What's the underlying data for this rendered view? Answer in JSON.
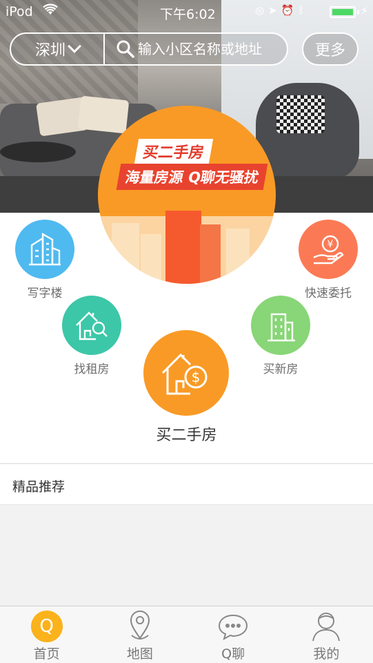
{
  "status_bar": {
    "carrier": "iPod",
    "time": "下午6:02"
  },
  "search": {
    "city": "深圳",
    "placeholder": "输入小区名称或地址"
  },
  "more_button": "更多",
  "promo": {
    "tag1": "买二手房",
    "tag2": "海量房源 Q聊无骚扰"
  },
  "features": {
    "office": "写字楼",
    "delegate": "快速委托",
    "rent": "找租房",
    "new_house": "买新房",
    "second_hand": "买二手房"
  },
  "recommend": {
    "title": "精品推荐"
  },
  "tabs": [
    {
      "label": "首页",
      "icon": "q-home-icon"
    },
    {
      "label": "地图",
      "icon": "map-pin-icon"
    },
    {
      "label": "Q聊",
      "icon": "chat-bubble-icon"
    },
    {
      "label": "我的",
      "icon": "user-icon"
    }
  ],
  "colors": {
    "accent": "#f99a26",
    "office": "#4fbaf0",
    "delegate": "#fb7a55",
    "rent": "#3cc7a8",
    "new_house": "#88d677",
    "tab_active": "#fbb21b"
  }
}
